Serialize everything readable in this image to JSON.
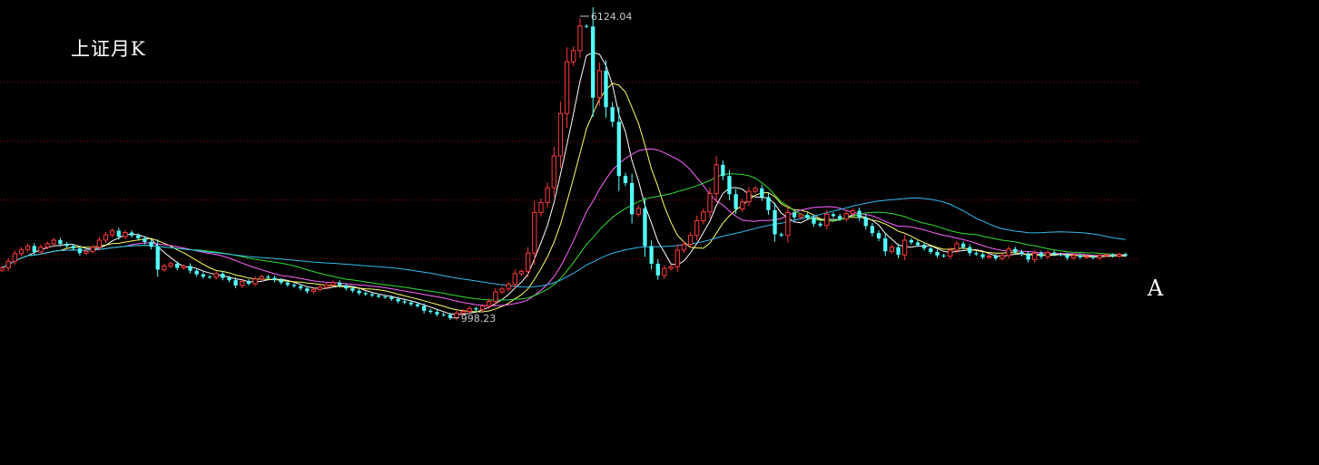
{
  "title": "上证月K",
  "marker_label": "A",
  "colors": {
    "background": "#000000",
    "up": "#ff3b3b",
    "down": "#54ffff",
    "grid": "#a01010",
    "annotation": "#c8c8c8",
    "ma1": "#ffffff",
    "ma2": "#ffff66",
    "ma3": "#ff66ff",
    "ma4": "#33dd33",
    "ma5": "#33bbee"
  },
  "chart_data": {
    "type": "candlestick",
    "title": "上证月K",
    "y_scale": "linear",
    "y_range": [
      -1500,
      6400
    ],
    "grid": "horizontal dotted",
    "high_annotation": {
      "label": "6124.04",
      "value": 6124.04
    },
    "low_annotation": {
      "label": "998.23",
      "value": 998.23
    },
    "close_series": [
      1850,
      1960,
      2090,
      2160,
      2220,
      2120,
      2200,
      2260,
      2320,
      2255,
      2220,
      2180,
      2100,
      2130,
      2200,
      2320,
      2410,
      2480,
      2380,
      2450,
      2400,
      2350,
      2290,
      2210,
      1820,
      1880,
      1920,
      1850,
      1880,
      1800,
      1740,
      1700,
      1690,
      1750,
      1680,
      1640,
      1550,
      1620,
      1580,
      1660,
      1700,
      1680,
      1640,
      1600,
      1560,
      1540,
      1500,
      1450,
      1480,
      1520,
      1560,
      1600,
      1550,
      1500,
      1460,
      1420,
      1400,
      1380,
      1360,
      1350,
      1320,
      1280,
      1260,
      1230,
      1200,
      1120,
      1100,
      1060,
      1050,
      1000,
      1080,
      1110,
      1160,
      1140,
      1200,
      1280,
      1440,
      1490,
      1570,
      1750,
      1790,
      2100,
      2790,
      2960,
      3210,
      3750,
      4470,
      5350,
      5540,
      5960,
      5950,
      4740,
      5200,
      4580,
      4330,
      3410,
      3290,
      2760,
      2860,
      2220,
      1920,
      1720,
      1840,
      1870,
      2150,
      2250,
      2400,
      2650,
      2800,
      3110,
      3600,
      3410,
      3100,
      2850,
      2970,
      3150,
      3200,
      3050,
      2830,
      2420,
      2400,
      2790,
      2710,
      2750,
      2700,
      2600,
      2570,
      2760,
      2730,
      2680,
      2770,
      2820,
      2700,
      2560,
      2440,
      2350,
      2130,
      2200,
      2070,
      2320,
      2280,
      2240,
      2180,
      2120,
      2060,
      2050,
      2150,
      2260,
      2200,
      2100,
      2080,
      2030,
      2050,
      2010,
      2060,
      2170,
      2120,
      2080,
      1990,
      2100,
      2040,
      2110,
      2080,
      2070,
      2020,
      2060,
      2030,
      2040,
      2020,
      2060,
      2070,
      2050,
      2080,
      2060
    ]
  }
}
